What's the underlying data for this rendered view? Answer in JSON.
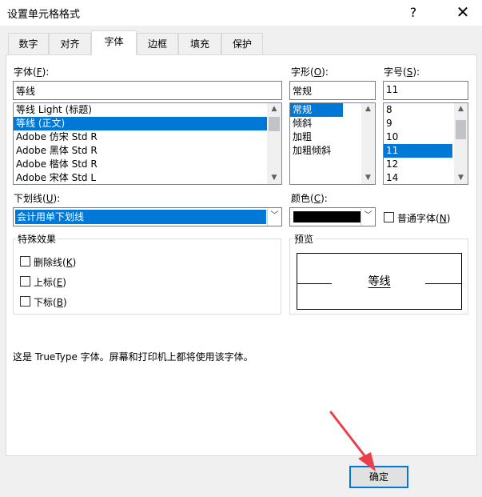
{
  "window": {
    "title": "设置单元格格式",
    "help_glyph": "?",
    "close_glyph": "✕"
  },
  "tabs": [
    {
      "label": "数字"
    },
    {
      "label": "对齐"
    },
    {
      "label": "字体",
      "active": true
    },
    {
      "label": "边框"
    },
    {
      "label": "填充"
    },
    {
      "label": "保护"
    }
  ],
  "font": {
    "label": "字体",
    "label_key": "F",
    "value": "等线",
    "items": [
      "等线 Light (标题)",
      "等线 (正文)",
      "Adobe 仿宋 Std R",
      "Adobe 黑体 Std R",
      "Adobe 楷体 Std R",
      "Adobe 宋体 Std L"
    ],
    "selected_index": 1
  },
  "style": {
    "label": "字形",
    "label_key": "O",
    "value": "常规",
    "items": [
      "常规",
      "倾斜",
      "加粗",
      "加粗倾斜"
    ],
    "selected_index": 0
  },
  "size": {
    "label": "字号",
    "label_key": "S",
    "value": "11",
    "items": [
      "8",
      "9",
      "10",
      "11",
      "12",
      "14"
    ],
    "selected_index": 3
  },
  "underline": {
    "label": "下划线",
    "label_key": "U",
    "value": "会计用单下划线"
  },
  "color": {
    "label": "颜色",
    "label_key": "C",
    "swatch": "#000000"
  },
  "normal_font": {
    "label": "普通字体",
    "label_key": "N",
    "checked": false
  },
  "effects": {
    "title": "特殊效果",
    "strikethrough": {
      "label": "删除线",
      "label_key": "K",
      "checked": false
    },
    "superscript": {
      "label": "上标",
      "label_key": "E",
      "checked": false
    },
    "subscript": {
      "label": "下标",
      "label_key": "B",
      "checked": false
    }
  },
  "preview": {
    "title": "预览",
    "sample": "等线"
  },
  "info_text": "这是 TrueType 字体。屏幕和打印机上都将使用该字体。",
  "ok_button": {
    "label": "确定"
  },
  "colors": {
    "selection": "#0078d7",
    "annotation_arrow": "#e8414b"
  }
}
